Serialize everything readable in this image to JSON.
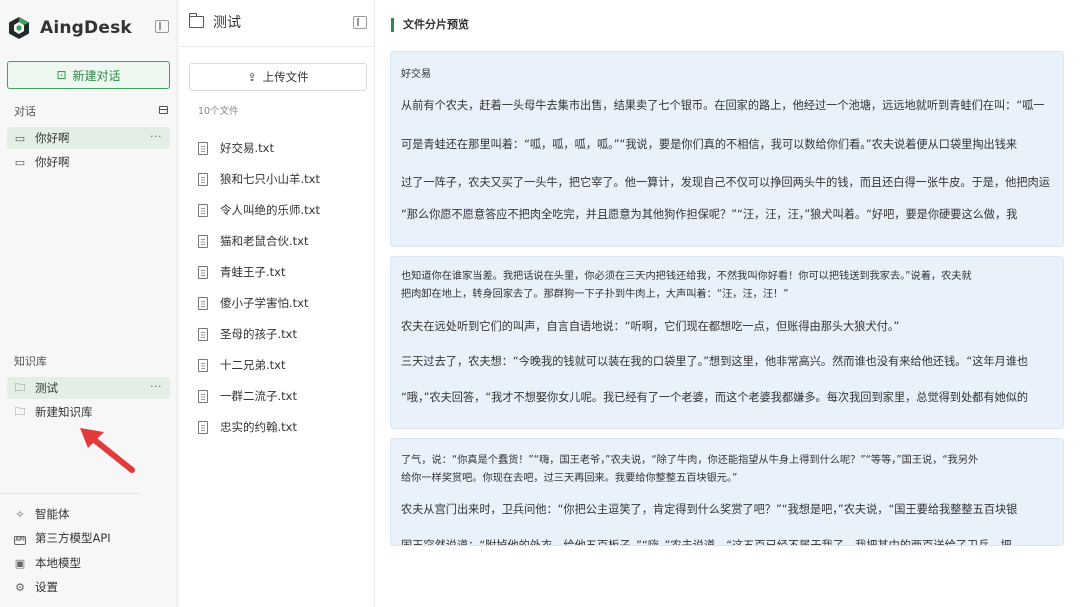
{
  "app": {
    "name": "AingDesk"
  },
  "sidebar": {
    "new_chat_label": "新建对话",
    "chats_label": "对话",
    "chats": [
      {
        "label": "你好啊",
        "more": "···"
      },
      {
        "label": "你好啊"
      }
    ],
    "kb_label": "知识库",
    "kb_items": [
      {
        "label": "测试",
        "more": "···"
      },
      {
        "label": "新建知识库"
      }
    ],
    "bottom": [
      {
        "label": "智能体",
        "icon": "agent-icon"
      },
      {
        "label": "第三方模型API",
        "icon": "api-icon",
        "badge": "API"
      },
      {
        "label": "本地模型",
        "icon": "local-model-icon"
      },
      {
        "label": "设置",
        "icon": "settings-icon"
      }
    ]
  },
  "files": {
    "title": "测试",
    "upload_label": "上传文件",
    "count_label": "10个文件",
    "items": [
      "好交易.txt",
      "狼和七只小山羊.txt",
      "令人叫绝的乐师.txt",
      "猫和老鼠合伙.txt",
      "青蛙王子.txt",
      "傻小子学害怕.txt",
      "圣母的孩子.txt",
      "十二兄弟.txt",
      "一群二流子.txt",
      "忠实的约翰.txt"
    ]
  },
  "main": {
    "title": "文件分片预览",
    "chunks": [
      {
        "lines": [
          "好交易",
          "从前有个农夫，赶着一头母牛去集市出售，结果卖了七个银币。在回家的路上，他经过一个池塘，远远地就听到青蛙们在叫：“呱一",
          "可是青蛙还在那里叫着：“呱，呱，呱，呱。”“我说，要是你们真的不相信，我可以数给你们看。”农夫说着便从口袋里掏出钱来",
          "过了一阵子，农夫又买了一头牛，把它宰了。他一算计，发现自己不仅可以挣回两头牛的钱，而且还白得一张牛皮。于是，他把肉运",
          "“那么你愿不愿意答应不把肉全吃完，并且愿意为其他狗作担保呢？”“汪，汪，汪，”狼犬叫着。“好吧，要是你硬要这么做，我"
        ]
      },
      {
        "lines": [
          "也知道你在谁家当差。我把话说在头里，你必须在三天内把钱还给我，不然我叫你好看！你可以把钱送到我家去。”说着，农夫就",
          "把肉卸在地上，转身回家去了。那群狗一下子扑到牛肉上，大声叫着：“汪，汪，汪！”",
          "农夫在远处听到它们的叫声，自言自语地说：“听啊，它们现在都想吃一点，但账得由那头大狼犬付。”",
          "三天过去了，农夫想：“今晚我的钱就可以装在我的口袋里了。”想到这里，他非常高兴。然而谁也没有来给他还钱。“这年月谁也",
          "“哦，”农夫回答，“我才不想娶你女儿呢。我已经有了一个老婆，而这个老婆我都嫌多。每次我回到家里，总觉得到处都有她似的"
        ]
      },
      {
        "lines": [
          "了气，说：“你真是个蠢货！”“嗨，国王老爷，”农夫说，“除了牛肉，你还能指望从牛身上得到什么呢？”“等等，”国王说，“我另外",
          "给你一样奖赏吧。你现在去吧，过三天再回来。我要给你整整五百块银元。”",
          "农夫从宫门出来时，卫兵问他：“你把公主逗笑了，肯定得到什么奖赏了吧？”“我想是吧，”农夫说，“国王要给我整整五百块银",
          "国王突然说道：“附掉他的外衣，给他五百板子。”“嗨，”农夫说道，“这五百已经不属于我了，我把其中的两百送给了卫兵，把"
        ]
      }
    ]
  },
  "colors": {
    "accent": "#2d8a47",
    "chunk_bg": "#e9f1fb",
    "arrow": "#e23b3b"
  }
}
